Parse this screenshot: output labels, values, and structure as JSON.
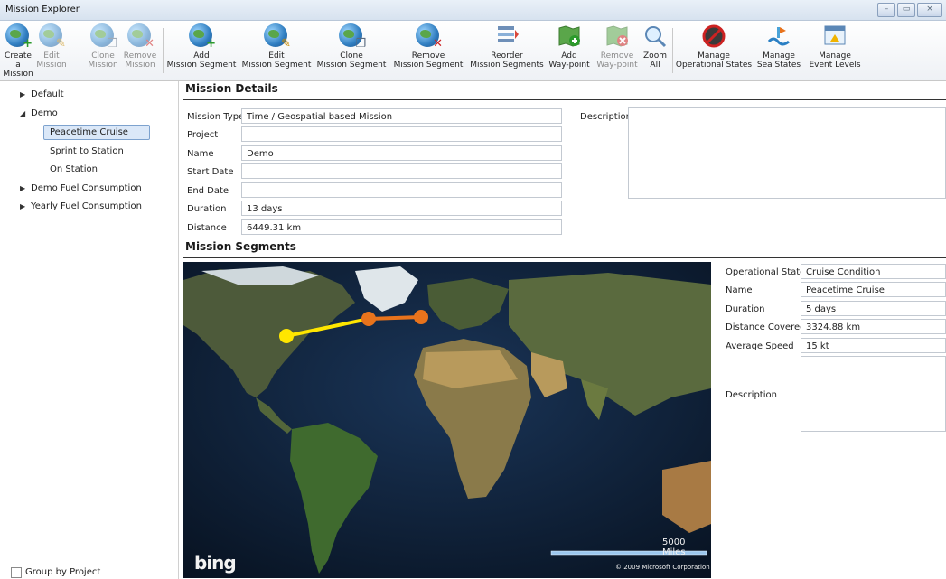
{
  "window": {
    "title": "Mission Explorer",
    "controls": [
      "minimize-icon",
      "restore-icon",
      "close-icon"
    ]
  },
  "toolbar": {
    "create_mission": [
      "Create a",
      "Mission"
    ],
    "edit_mission": [
      "Edit",
      "Mission"
    ],
    "clone_mission": [
      "Clone",
      "Mission"
    ],
    "remove_mission": [
      "Remove",
      "Mission"
    ],
    "add_segment": [
      "Add",
      "Mission Segment"
    ],
    "edit_segment": [
      "Edit",
      "Mission Segment"
    ],
    "clone_segment": [
      "Clone",
      "Mission Segment"
    ],
    "remove_segment": [
      "Remove",
      "Mission Segment"
    ],
    "reorder_segments": [
      "Reorder",
      "Mission Segments"
    ],
    "add_waypoint": [
      "Add",
      "Way-point"
    ],
    "remove_waypoint": [
      "Remove",
      "Way-point"
    ],
    "zoom_all": [
      "Zoom",
      "All"
    ],
    "manage_opstates": [
      "Manage",
      "Operational States"
    ],
    "manage_seastates": [
      "Manage",
      "Sea States"
    ],
    "manage_eventlevels": [
      "Manage",
      "Event Levels"
    ]
  },
  "tree": {
    "items": [
      {
        "label": "Default",
        "expanded": false
      },
      {
        "label": "Demo",
        "expanded": true
      },
      {
        "label": "Peacetime Cruise",
        "selected": true
      },
      {
        "label": "Sprint to Station"
      },
      {
        "label": "On Station"
      },
      {
        "label": "Demo Fuel Consumption",
        "expanded": false
      },
      {
        "label": "Yearly Fuel Consumption",
        "expanded": false
      }
    ],
    "group_by_project": "Group by Project"
  },
  "details": {
    "title": "Mission Details",
    "mission_type_label": "Mission Type",
    "mission_type": "Time / Geospatial based Mission",
    "project_label": "Project",
    "project": "",
    "name_label": "Name",
    "name": "Demo",
    "start_date_label": "Start Date",
    "start_date": "",
    "end_date_label": "End Date",
    "end_date": "",
    "duration_label": "Duration",
    "duration": "13 days",
    "distance_label": "Distance",
    "distance": "6449.31 km",
    "description_label": "Description",
    "description": ""
  },
  "segments": {
    "title": "Mission Segments",
    "opstate_label": "Operational State",
    "opstate": "Cruise Condition",
    "name_label": "Name",
    "name": "Peacetime Cruise",
    "duration_label": "Duration",
    "duration": "5 days",
    "distance_label": "Distance Covered",
    "distance": "3324.88 km",
    "speed_label": "Average Speed",
    "speed": "15 kt",
    "description_label": "Description",
    "description": ""
  },
  "map": {
    "logo": "bing",
    "scale_label": "5000 Miles",
    "copyright": "© 2009 Microsoft Corporation",
    "route_colors": [
      "#ffe600",
      "#e8731c"
    ]
  }
}
